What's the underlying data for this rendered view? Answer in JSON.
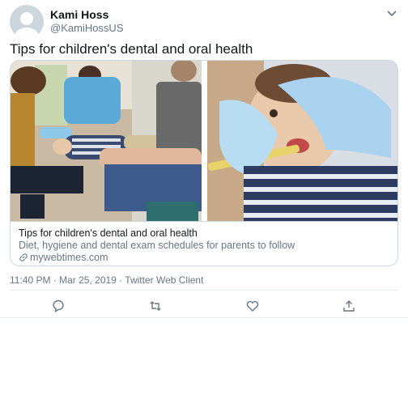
{
  "author": {
    "name": "Kami Hoss",
    "handle": "@KamiHossUS",
    "avatar_icon": "default-profile-icon"
  },
  "tweet": {
    "text": "Tips for children's dental and oral health"
  },
  "card": {
    "title": "Tips for children's dental and oral health",
    "description": "Diet, hygiene and dental exam schedules for parents to follow",
    "domain": "mywebtimes.com",
    "link_icon": "link-icon"
  },
  "meta": {
    "timestamp": "11:40 PM · Mar 25, 2019 · Twitter Web Client"
  },
  "actions": [
    "reply-icon",
    "retweet-icon",
    "like-icon",
    "share-icon"
  ],
  "colors": {
    "text": "#14171a",
    "secondary": "#657786",
    "border": "#ccd6dd"
  }
}
